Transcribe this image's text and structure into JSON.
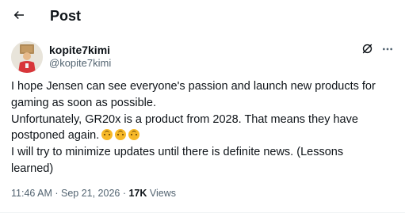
{
  "header": {
    "title": "Post"
  },
  "author": {
    "display_name": "kopite7kimi",
    "handle": "@kopite7kimi"
  },
  "tweet": {
    "lines": [
      "I hope Jensen can see everyone's passion and launch new products for",
      "gaming as soon as possible.",
      "Unfortunately, GR20x is a product from 2028. That means they have",
      "postponed again.",
      "I will try to minimize updates until there is definite news. (Lessons",
      "learned)"
    ]
  },
  "meta": {
    "timestamp": "11:46 AM · Sep 21, 2026",
    "separator": " · ",
    "views_count": "17K",
    "views_label": " Views"
  },
  "icons": {
    "back": "arrow-left-icon",
    "grok": "grok-icon",
    "more": "more-horizontal-icon",
    "emoji": "upside-down-face-emoji"
  },
  "colors": {
    "text": "#0f1419",
    "secondary": "#536471",
    "divider": "#eff3f4"
  }
}
